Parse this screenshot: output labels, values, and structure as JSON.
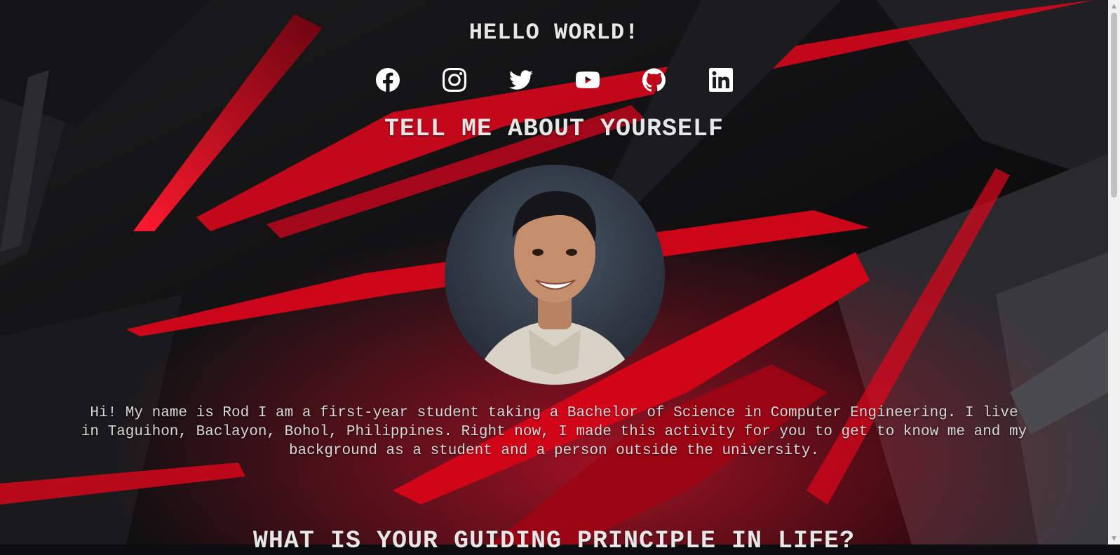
{
  "header": {
    "title": "HELLO WORLD!"
  },
  "socials": [
    {
      "icon": "facebook-icon"
    },
    {
      "icon": "instagram-icon"
    },
    {
      "icon": "twitter-icon"
    },
    {
      "icon": "youtube-icon"
    },
    {
      "icon": "github-icon"
    },
    {
      "icon": "linkedin-icon"
    }
  ],
  "about": {
    "heading": "TELL ME ABOUT YOURSELF",
    "bio": "Hi! My name is Rod I am a first-year student taking a Bachelor of Science in Computer Engineering. I live in Taguihon, Baclayon, Bohol, Philippines. Right now, I made this activity for you to get to know me and my background as a student and a person outside the university."
  },
  "next_section": {
    "heading": "WHAT IS YOUR GUIDING PRINCIPLE IN LIFE?"
  },
  "colors": {
    "accent": "#e0061b",
    "background": "#0d0d0f",
    "text": "#e6e6e6"
  }
}
